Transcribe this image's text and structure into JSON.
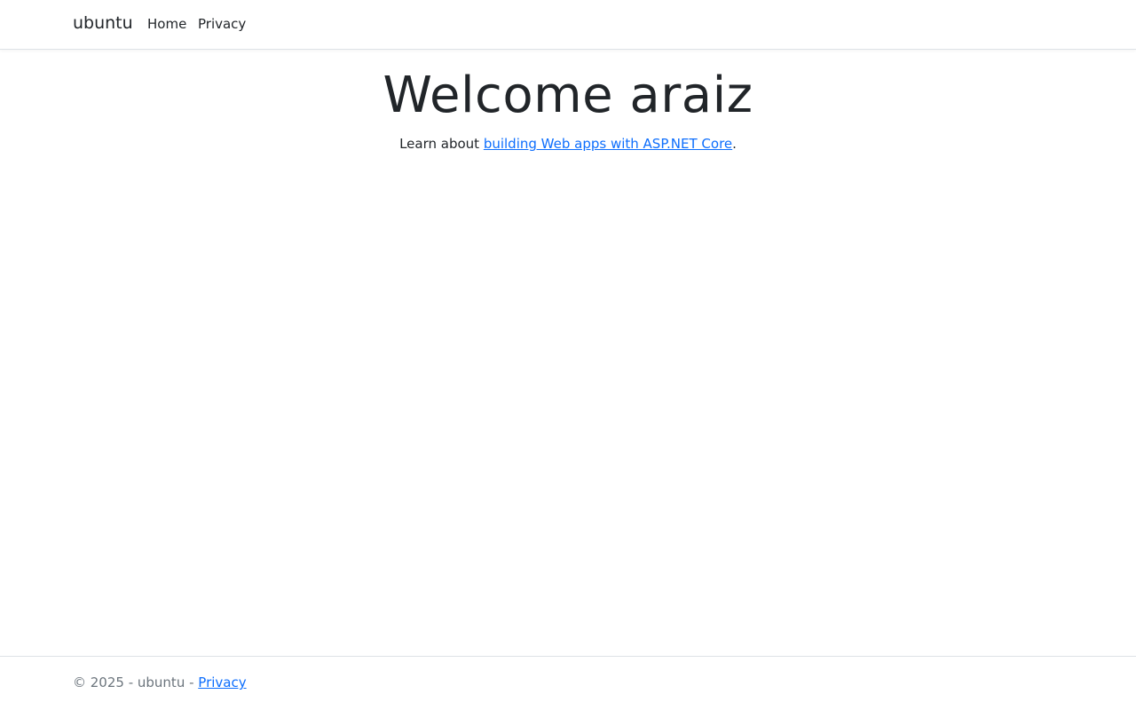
{
  "navbar": {
    "brand": "ubuntu",
    "links": [
      {
        "label": "Home"
      },
      {
        "label": "Privacy"
      }
    ]
  },
  "main": {
    "heading": "Welcome araiz",
    "text_before": "Learn about ",
    "link_label": "building Web apps with ASP.NET Core",
    "text_after": "."
  },
  "footer": {
    "copyright": "© 2025 - ubuntu - ",
    "privacy_label": "Privacy"
  },
  "colors": {
    "link": "#0d6efd",
    "text": "#212529",
    "muted": "#6c757d",
    "border": "#dee2e6"
  }
}
